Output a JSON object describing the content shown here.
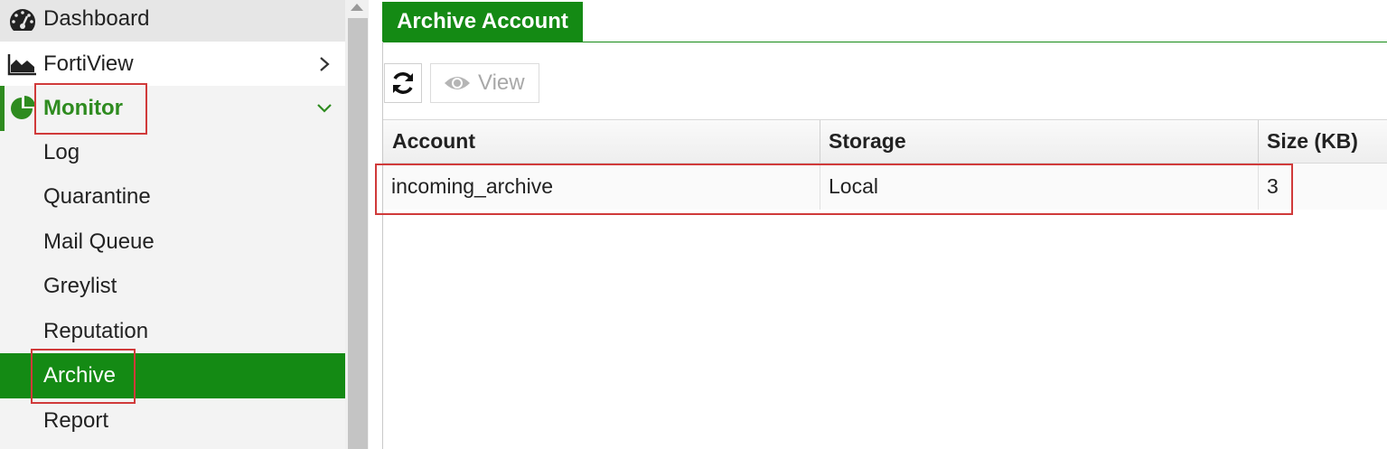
{
  "sidebar": {
    "items": [
      {
        "label": "Dashboard",
        "icon": "dashboard-icon"
      },
      {
        "label": "FortiView",
        "icon": "fortiview-chart-icon"
      },
      {
        "label": "Monitor",
        "icon": "pie-chart-icon"
      }
    ],
    "monitor_children": [
      "Log",
      "Quarantine",
      "Mail Queue",
      "Greylist",
      "Reputation",
      "Archive",
      "Report"
    ],
    "active_item": "Archive"
  },
  "main": {
    "tab_label": "Archive Account",
    "toolbar": {
      "refresh_icon": "refresh-icon",
      "view_label": "View",
      "view_icon": "eye-icon"
    },
    "table": {
      "columns": [
        "Account",
        "Storage",
        "Size (KB)"
      ],
      "rows": [
        {
          "account": "incoming_archive",
          "storage": "Local",
          "size": "3"
        }
      ]
    }
  },
  "colors": {
    "accent": "#148a14",
    "monitor_text": "#2e8b1f",
    "annotation_box": "#d03a3a"
  }
}
